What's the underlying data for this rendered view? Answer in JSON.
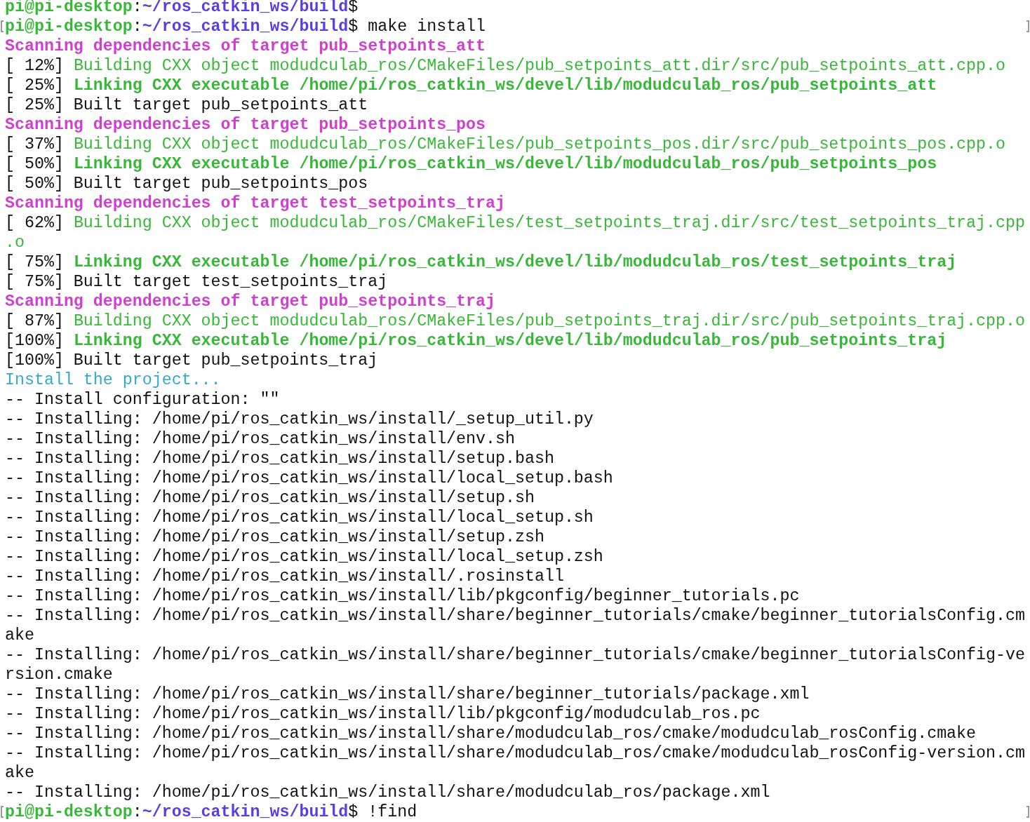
{
  "terminal": {
    "lines": [
      {
        "marked": false,
        "segments": [
          {
            "kind": "user",
            "text": "pi@pi-desktop"
          },
          {
            "kind": "plain",
            "text": ":"
          },
          {
            "kind": "path",
            "text": "~/ros_catkin_ws/build"
          },
          {
            "kind": "plain",
            "text": "$"
          }
        ]
      },
      {
        "marked": true,
        "segments": [
          {
            "kind": "user",
            "text": "pi@pi-desktop"
          },
          {
            "kind": "plain",
            "text": ":"
          },
          {
            "kind": "path",
            "text": "~/ros_catkin_ws/build"
          },
          {
            "kind": "plain",
            "text": "$ make install"
          }
        ]
      },
      {
        "marked": false,
        "segments": [
          {
            "kind": "scan",
            "text": "Scanning dependencies of target pub_setpoints_att"
          }
        ]
      },
      {
        "marked": false,
        "segments": [
          {
            "kind": "plain",
            "text": "[ 12%] "
          },
          {
            "kind": "build",
            "text": "Building CXX object modudculab_ros/CMakeFiles/pub_setpoints_att.dir/src/pub_setpoints_att.cpp.o"
          }
        ]
      },
      {
        "marked": false,
        "segments": [
          {
            "kind": "plain",
            "text": "[ 25%] "
          },
          {
            "kind": "link",
            "text": "Linking CXX executable /home/pi/ros_catkin_ws/devel/lib/modudculab_ros/pub_setpoints_att"
          }
        ]
      },
      {
        "marked": false,
        "segments": [
          {
            "kind": "plain",
            "text": "[ 25%] Built target pub_setpoints_att"
          }
        ]
      },
      {
        "marked": false,
        "segments": [
          {
            "kind": "scan",
            "text": "Scanning dependencies of target pub_setpoints_pos"
          }
        ]
      },
      {
        "marked": false,
        "segments": [
          {
            "kind": "plain",
            "text": "[ 37%] "
          },
          {
            "kind": "build",
            "text": "Building CXX object modudculab_ros/CMakeFiles/pub_setpoints_pos.dir/src/pub_setpoints_pos.cpp.o"
          }
        ]
      },
      {
        "marked": false,
        "segments": [
          {
            "kind": "plain",
            "text": "[ 50%] "
          },
          {
            "kind": "link",
            "text": "Linking CXX executable /home/pi/ros_catkin_ws/devel/lib/modudculab_ros/pub_setpoints_pos"
          }
        ]
      },
      {
        "marked": false,
        "segments": [
          {
            "kind": "plain",
            "text": "[ 50%] Built target pub_setpoints_pos"
          }
        ]
      },
      {
        "marked": false,
        "segments": [
          {
            "kind": "scan",
            "text": "Scanning dependencies of target test_setpoints_traj"
          }
        ]
      },
      {
        "marked": false,
        "segments": [
          {
            "kind": "plain",
            "text": "[ 62%] "
          },
          {
            "kind": "build",
            "text": "Building CXX object modudculab_ros/CMakeFiles/test_setpoints_traj.dir/src/test_setpoints_traj.cpp"
          }
        ]
      },
      {
        "marked": false,
        "segments": [
          {
            "kind": "build",
            "text": ".o"
          }
        ]
      },
      {
        "marked": false,
        "segments": [
          {
            "kind": "plain",
            "text": "[ 75%] "
          },
          {
            "kind": "link",
            "text": "Linking CXX executable /home/pi/ros_catkin_ws/devel/lib/modudculab_ros/test_setpoints_traj"
          }
        ]
      },
      {
        "marked": false,
        "segments": [
          {
            "kind": "plain",
            "text": "[ 75%] Built target test_setpoints_traj"
          }
        ]
      },
      {
        "marked": false,
        "segments": [
          {
            "kind": "scan",
            "text": "Scanning dependencies of target pub_setpoints_traj"
          }
        ]
      },
      {
        "marked": false,
        "segments": [
          {
            "kind": "plain",
            "text": "[ 87%] "
          },
          {
            "kind": "build",
            "text": "Building CXX object modudculab_ros/CMakeFiles/pub_setpoints_traj.dir/src/pub_setpoints_traj.cpp.o"
          }
        ]
      },
      {
        "marked": false,
        "segments": [
          {
            "kind": "plain",
            "text": "[100%] "
          },
          {
            "kind": "link",
            "text": "Linking CXX executable /home/pi/ros_catkin_ws/devel/lib/modudculab_ros/pub_setpoints_traj"
          }
        ]
      },
      {
        "marked": false,
        "segments": [
          {
            "kind": "plain",
            "text": "[100%] Built target pub_setpoints_traj"
          }
        ]
      },
      {
        "marked": false,
        "segments": [
          {
            "kind": "install",
            "text": "Install the project..."
          }
        ]
      },
      {
        "marked": false,
        "segments": [
          {
            "kind": "plain",
            "text": "-- Install configuration: \"\""
          }
        ]
      },
      {
        "marked": false,
        "segments": [
          {
            "kind": "plain",
            "text": "-- Installing: /home/pi/ros_catkin_ws/install/_setup_util.py"
          }
        ]
      },
      {
        "marked": false,
        "segments": [
          {
            "kind": "plain",
            "text": "-- Installing: /home/pi/ros_catkin_ws/install/env.sh"
          }
        ]
      },
      {
        "marked": false,
        "segments": [
          {
            "kind": "plain",
            "text": "-- Installing: /home/pi/ros_catkin_ws/install/setup.bash"
          }
        ]
      },
      {
        "marked": false,
        "segments": [
          {
            "kind": "plain",
            "text": "-- Installing: /home/pi/ros_catkin_ws/install/local_setup.bash"
          }
        ]
      },
      {
        "marked": false,
        "segments": [
          {
            "kind": "plain",
            "text": "-- Installing: /home/pi/ros_catkin_ws/install/setup.sh"
          }
        ]
      },
      {
        "marked": false,
        "segments": [
          {
            "kind": "plain",
            "text": "-- Installing: /home/pi/ros_catkin_ws/install/local_setup.sh"
          }
        ]
      },
      {
        "marked": false,
        "segments": [
          {
            "kind": "plain",
            "text": "-- Installing: /home/pi/ros_catkin_ws/install/setup.zsh"
          }
        ]
      },
      {
        "marked": false,
        "segments": [
          {
            "kind": "plain",
            "text": "-- Installing: /home/pi/ros_catkin_ws/install/local_setup.zsh"
          }
        ]
      },
      {
        "marked": false,
        "segments": [
          {
            "kind": "plain",
            "text": "-- Installing: /home/pi/ros_catkin_ws/install/.rosinstall"
          }
        ]
      },
      {
        "marked": false,
        "segments": [
          {
            "kind": "plain",
            "text": "-- Installing: /home/pi/ros_catkin_ws/install/lib/pkgconfig/beginner_tutorials.pc"
          }
        ]
      },
      {
        "marked": false,
        "segments": [
          {
            "kind": "plain",
            "text": "-- Installing: /home/pi/ros_catkin_ws/install/share/beginner_tutorials/cmake/beginner_tutorialsConfig.cm"
          }
        ]
      },
      {
        "marked": false,
        "segments": [
          {
            "kind": "plain",
            "text": "ake"
          }
        ]
      },
      {
        "marked": false,
        "segments": [
          {
            "kind": "plain",
            "text": "-- Installing: /home/pi/ros_catkin_ws/install/share/beginner_tutorials/cmake/beginner_tutorialsConfig-ve"
          }
        ]
      },
      {
        "marked": false,
        "segments": [
          {
            "kind": "plain",
            "text": "rsion.cmake"
          }
        ]
      },
      {
        "marked": false,
        "segments": [
          {
            "kind": "plain",
            "text": "-- Installing: /home/pi/ros_catkin_ws/install/share/beginner_tutorials/package.xml"
          }
        ]
      },
      {
        "marked": false,
        "segments": [
          {
            "kind": "plain",
            "text": "-- Installing: /home/pi/ros_catkin_ws/install/lib/pkgconfig/modudculab_ros.pc"
          }
        ]
      },
      {
        "marked": false,
        "segments": [
          {
            "kind": "plain",
            "text": "-- Installing: /home/pi/ros_catkin_ws/install/share/modudculab_ros/cmake/modudculab_rosConfig.cmake"
          }
        ]
      },
      {
        "marked": false,
        "segments": [
          {
            "kind": "plain",
            "text": "-- Installing: /home/pi/ros_catkin_ws/install/share/modudculab_ros/cmake/modudculab_rosConfig-version.cm"
          }
        ]
      },
      {
        "marked": false,
        "segments": [
          {
            "kind": "plain",
            "text": "ake"
          }
        ]
      },
      {
        "marked": false,
        "segments": [
          {
            "kind": "plain",
            "text": "-- Installing: /home/pi/ros_catkin_ws/install/share/modudculab_ros/package.xml"
          }
        ]
      },
      {
        "marked": true,
        "segments": [
          {
            "kind": "user",
            "text": "pi@pi-desktop"
          },
          {
            "kind": "plain",
            "text": ":"
          },
          {
            "kind": "path",
            "text": "~/ros_catkin_ws/build"
          },
          {
            "kind": "plain",
            "text": "$ !find"
          }
        ]
      }
    ]
  }
}
